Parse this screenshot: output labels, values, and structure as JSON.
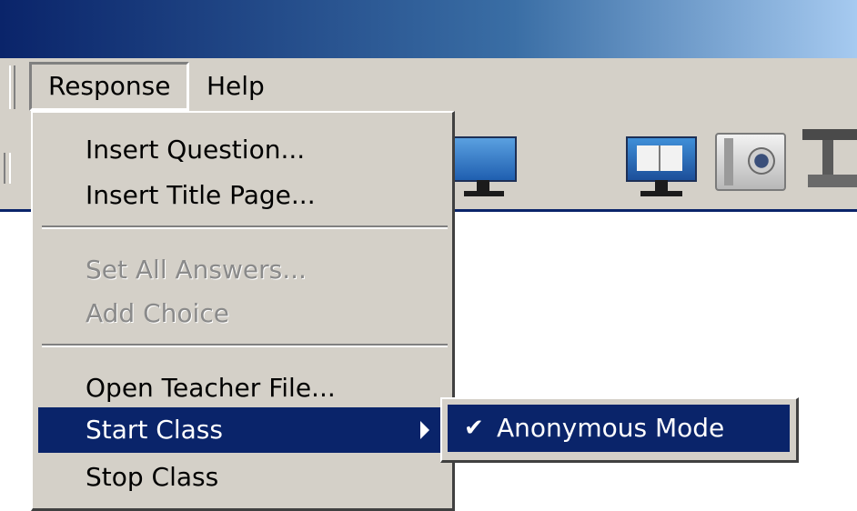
{
  "menubar": {
    "items": [
      {
        "label": "Response"
      },
      {
        "label": "Help"
      }
    ]
  },
  "toolbar": {
    "icons": [
      "monitor-icon",
      "monitor-book-icon",
      "camera-icon",
      "document-camera-icon"
    ]
  },
  "response_menu": {
    "items": [
      {
        "label": "Insert Question...",
        "enabled": true
      },
      {
        "label": "Insert Title Page...",
        "enabled": true
      },
      {
        "label": "Set All Answers...",
        "enabled": false
      },
      {
        "label": "Add Choice",
        "enabled": false
      },
      {
        "label": "Open Teacher File...",
        "enabled": true
      },
      {
        "label": "Start Class",
        "enabled": true,
        "highlighted": true,
        "has_submenu": true
      },
      {
        "label": "Stop Class",
        "enabled": true
      }
    ]
  },
  "start_class_submenu": {
    "items": [
      {
        "label": "Anonymous Mode",
        "checked": true,
        "check_glyph": "✔"
      }
    ]
  },
  "colors": {
    "menu_bg": "#d4d0c8",
    "highlight": "#0a246a",
    "highlight_text": "#ffffff",
    "disabled_text": "#8a8a8a"
  }
}
